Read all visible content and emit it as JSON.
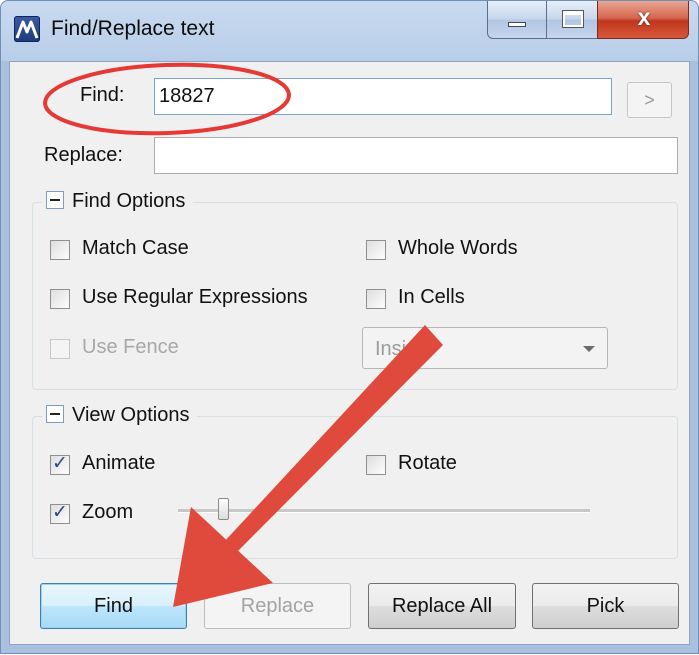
{
  "window": {
    "title": "Find/Replace text",
    "close_glyph": "x"
  },
  "find": {
    "label": "Find:",
    "value": "18827",
    "next_button": ">"
  },
  "replace": {
    "label": "Replace:",
    "value": ""
  },
  "find_options": {
    "title": "Find Options",
    "match_case": {
      "label": "Match Case",
      "checked": false
    },
    "whole_words": {
      "label": "Whole Words",
      "checked": false
    },
    "use_regex": {
      "label": "Use Regular Expressions",
      "checked": false
    },
    "in_cells": {
      "label": "In Cells",
      "checked": false
    },
    "use_fence": {
      "label": "Use Fence",
      "checked": false,
      "enabled": false
    },
    "fence_mode": {
      "value": "Inside",
      "enabled": false
    }
  },
  "view_options": {
    "title": "View Options",
    "animate": {
      "label": "Animate",
      "checked": true
    },
    "rotate": {
      "label": "Rotate",
      "checked": false
    },
    "zoom": {
      "label": "Zoom",
      "checked": true,
      "level": 0.1
    }
  },
  "buttons": {
    "find": "Find",
    "replace": "Replace",
    "replace_all": "Replace All",
    "pick": "Pick"
  },
  "colors": {
    "annotation": "#e53935",
    "arrow": "#e04a3c",
    "check": "#264c87"
  },
  "icons": {
    "app": "app-logo-icon",
    "minimize": "minimize-icon",
    "maximize": "maximize-icon",
    "close": "close-icon",
    "collapse": "minus-icon",
    "dropdown": "chevron-down-icon"
  }
}
